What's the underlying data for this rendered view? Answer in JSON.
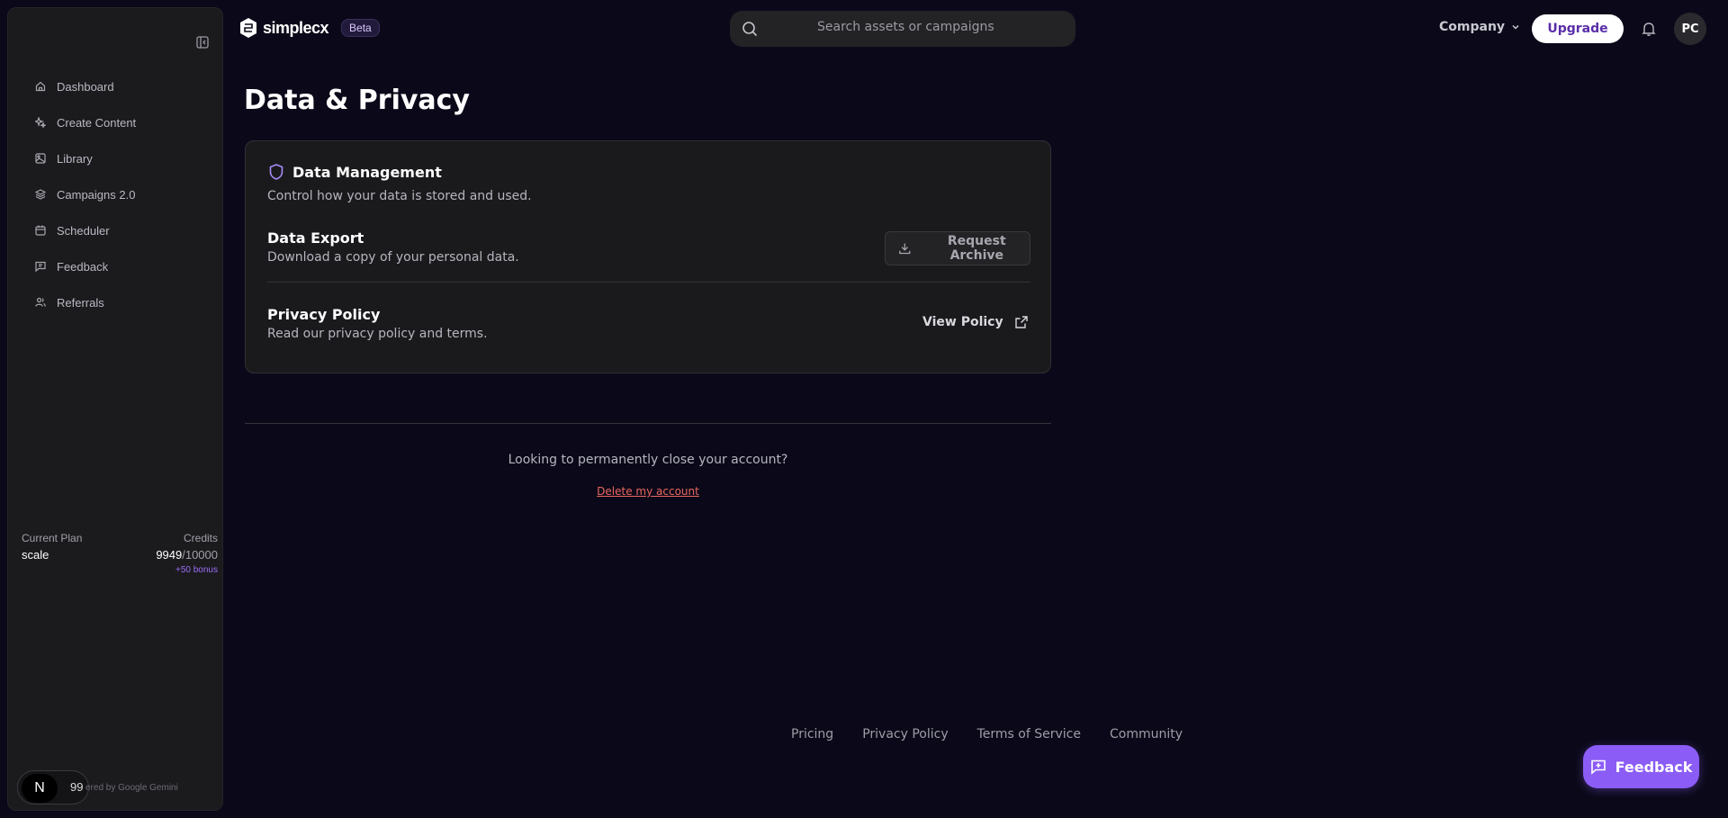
{
  "sidebar": {
    "items": [
      {
        "label": "Dashboard",
        "icon": "home-icon"
      },
      {
        "label": "Create Content",
        "icon": "sparkles-icon"
      },
      {
        "label": "Library",
        "icon": "image-icon"
      },
      {
        "label": "Campaigns 2.0",
        "icon": "layers-icon"
      },
      {
        "label": "Scheduler",
        "icon": "calendar-icon"
      },
      {
        "label": "Feedback",
        "icon": "message-icon"
      },
      {
        "label": "Referrals",
        "icon": "users-icon"
      }
    ],
    "plan": {
      "plan_label": "Current Plan",
      "plan_value": "scale",
      "credits_label": "Credits",
      "credits_used": "9949",
      "credits_total": "/10000",
      "bonus": "+50 bonus"
    },
    "badge_letter": "N",
    "badge_count": "99",
    "powered_by": "ered by Google Gemini"
  },
  "header": {
    "logo_text": "simplecx",
    "beta": "Beta",
    "search_placeholder": "Search assets or campaigns",
    "company": "Company",
    "upgrade": "Upgrade",
    "avatar": "PC"
  },
  "main": {
    "title": "Data & Privacy",
    "card": {
      "title": "Data Management",
      "desc": "Control how your data is stored and used.",
      "export_title": "Data Export",
      "export_desc": "Download a copy of your personal data.",
      "export_button": "Request Archive",
      "privacy_title": "Privacy Policy",
      "privacy_desc": "Read our privacy policy and terms.",
      "privacy_button": "View Policy"
    },
    "close_question": "Looking to permanently close your account?",
    "delete_link": "Delete my account"
  },
  "footer": {
    "links": [
      "Pricing",
      "Privacy Policy",
      "Terms of Service",
      "Community"
    ]
  },
  "fab": {
    "label": "Feedback"
  },
  "colors": {
    "background": "#0b0919",
    "sidebar": "#1b1b1e",
    "accent": "#8b5cf6",
    "danger": "#e9665f"
  }
}
